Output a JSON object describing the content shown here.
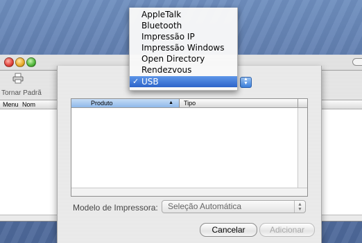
{
  "background_window": {
    "toolbar": {
      "make_default_label": "Tornar Padrã"
    },
    "columns": [
      "Menu",
      "Nom"
    ]
  },
  "connection_menu": {
    "items": [
      {
        "label": "AppleTalk",
        "checked": false
      },
      {
        "label": "Bluetooth",
        "checked": false
      },
      {
        "label": "Impressão IP",
        "checked": false
      },
      {
        "label": "Impressão Windows",
        "checked": false
      },
      {
        "label": "Open Directory",
        "checked": false
      },
      {
        "label": "Rendezvous",
        "checked": false
      },
      {
        "label": "USB",
        "checked": true
      }
    ],
    "check_glyph": "✓"
  },
  "printer_table": {
    "columns": {
      "produto": "Produto",
      "tipo": "Tipo"
    },
    "sort_indicator": "▲",
    "rows": []
  },
  "modelo": {
    "label": "Modelo de Impressora:",
    "value": "Seleção Automática"
  },
  "buttons": {
    "cancel": "Cancelar",
    "add": "Adicionar"
  },
  "colors": {
    "selection": "#2d64c9",
    "desktop": "#5a79ac"
  }
}
